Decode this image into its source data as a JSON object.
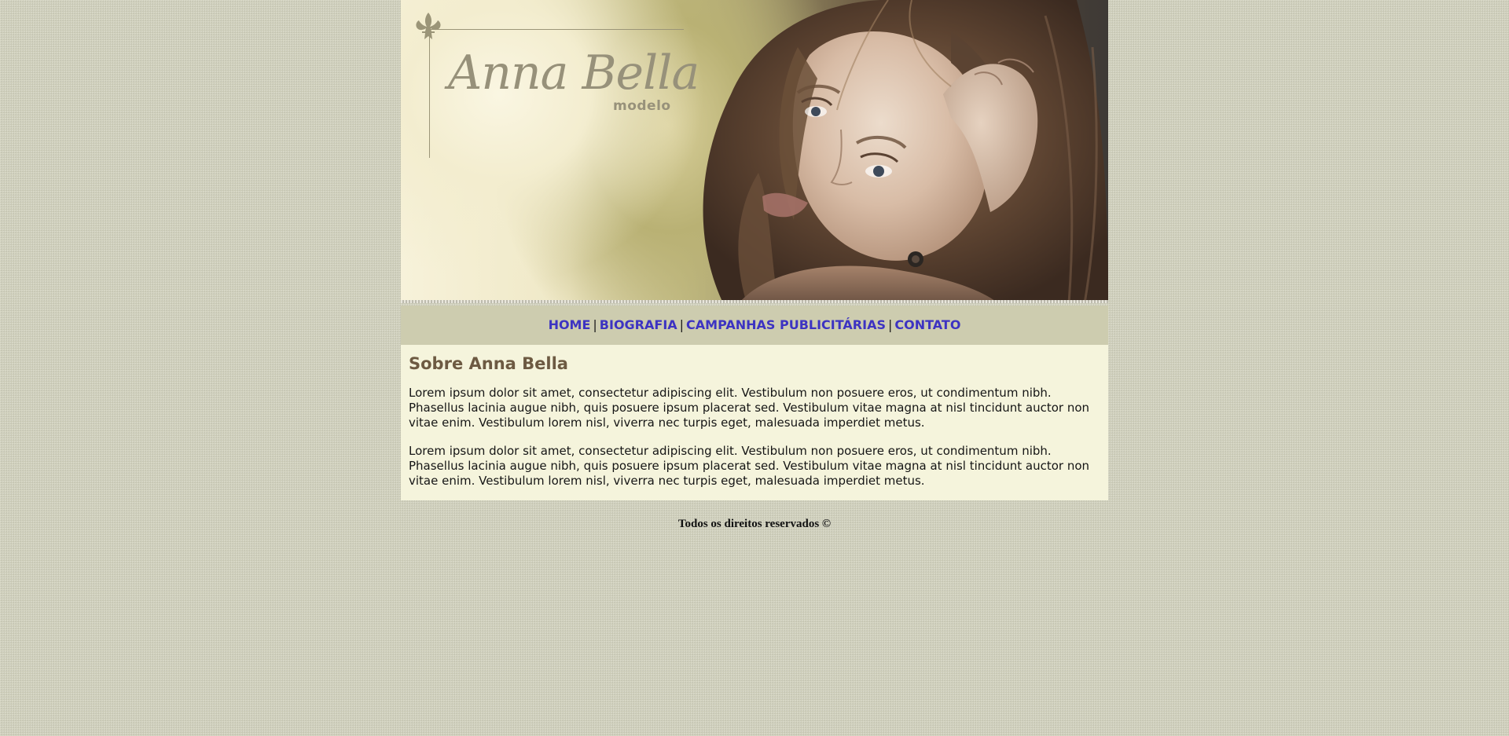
{
  "header": {
    "logo_name": "Anna Bella",
    "logo_subtitle": "modelo",
    "banner_image": "portrait-of-woman"
  },
  "nav": {
    "items": [
      {
        "label": "HOME"
      },
      {
        "label": "BIOGRAFIA"
      },
      {
        "label": "CAMPANHAS PUBLICITÁRIAS"
      },
      {
        "label": "CONTATO"
      }
    ],
    "separator": "|"
  },
  "content": {
    "title": "Sobre Anna Bella",
    "paragraphs": [
      "Lorem ipsum dolor sit amet, consectetur adipiscing elit. Vestibulum non posuere eros, ut condimentum nibh. Phasellus lacinia augue nibh, quis posuere ipsum placerat sed. Vestibulum vitae magna at nisl tincidunt auctor non vitae enim. Vestibulum lorem nisl, viverra nec turpis eget, malesuada imperdiet metus.",
      "Lorem ipsum dolor sit amet, consectetur adipiscing elit. Vestibulum non posuere eros, ut condimentum nibh. Phasellus lacinia augue nibh, quis posuere ipsum placerat sed. Vestibulum vitae magna at nisl tincidunt auctor non vitae enim. Vestibulum lorem nisl, viverra nec turpis eget, malesuada imperdiet metus."
    ]
  },
  "footer": {
    "text": "Todos os direitos reservados ©"
  },
  "colors": {
    "page_background": "#d0d0bc",
    "nav_background": "#cdccaf",
    "nav_link": "#3d33c2",
    "content_background": "#f5f4dc",
    "heading": "#6d5a42",
    "logo": "#97917a"
  }
}
